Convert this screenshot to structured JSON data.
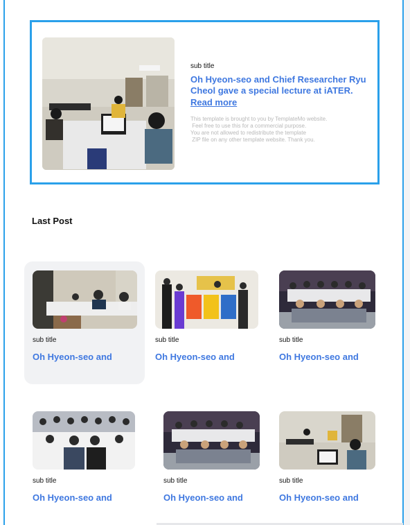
{
  "featured": {
    "subtitle": "sub title",
    "headline": "Oh Hyeon-seo and Chief Researcher Ryu Cheol gave a special lecture at iATER.",
    "read_more": "Read more",
    "notice_lines": [
      "This template is brought to you by TemplateMo website.",
      " Feel free to use this for a commercial purpose.",
      "You are not allowed to redistribute the template",
      " ZIP file on any other template website. Thank you."
    ]
  },
  "last_post": {
    "title": "Last Post",
    "cards": [
      {
        "subtitle": "sub title",
        "title": "Oh Hyeon-seo and"
      },
      {
        "subtitle": "sub title",
        "title": "Oh Hyeon-seo and"
      },
      {
        "subtitle": "sub title",
        "title": "Oh Hyeon-seo and"
      },
      {
        "subtitle": "sub title",
        "title": "Oh Hyeon-seo and"
      },
      {
        "subtitle": "sub title",
        "title": "Oh Hyeon-seo and"
      },
      {
        "subtitle": "sub title",
        "title": "Oh Hyeon-seo and"
      }
    ]
  },
  "colors": {
    "accent": "#2aa0ea",
    "link": "#3f78e0",
    "card_highlight": "#f1f2f4"
  }
}
